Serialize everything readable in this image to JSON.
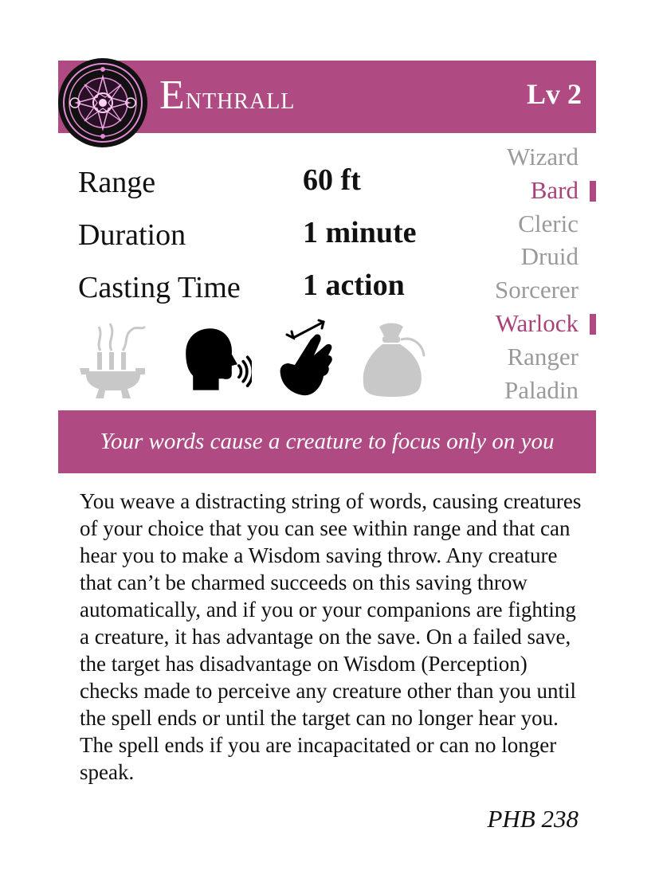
{
  "spell": {
    "name_first": "E",
    "name_rest": "nthrall",
    "level": "Lv 2",
    "school_icon": "enchantment-seal-icon"
  },
  "stats": {
    "range_label": "Range",
    "range_value": "60 ft",
    "duration_label": "Duration",
    "duration_value": "1 minute",
    "casting_label": "Casting Time",
    "casting_value": "1 action"
  },
  "classes": [
    {
      "name": "Wizard",
      "active": false
    },
    {
      "name": "Bard",
      "active": true
    },
    {
      "name": "Cleric",
      "active": false
    },
    {
      "name": "Druid",
      "active": false
    },
    {
      "name": "Sorcerer",
      "active": false
    },
    {
      "name": "Warlock",
      "active": true
    },
    {
      "name": "Ranger",
      "active": false
    },
    {
      "name": "Paladin",
      "active": false
    }
  ],
  "components": {
    "ritual": {
      "icon": "ritual-incense-icon",
      "active": false
    },
    "verbal": {
      "icon": "verbal-speaking-head-icon",
      "active": true
    },
    "somatic": {
      "icon": "somatic-hand-icon",
      "active": true
    },
    "material": {
      "icon": "material-pouch-icon",
      "active": false
    }
  },
  "colors": {
    "accent": "#b04a82",
    "active_class": "#a8437a",
    "inactive": "#9a9a9a"
  },
  "tagline": "Your words cause a creature to focus only on you",
  "description": "You weave a distracting string of words, causing creatures of your choice that you can see within range and that can hear you to make a Wisdom saving throw. Any creature that can’t be charmed succeeds on this saving throw automatically, and if you or your companions are fighting a creature, it has advantage on the save. On a failed save, the target has disadvantage on Wisdom (Perception) checks made to perceive any creature other than you until the spell ends or until the target can no longer hear you. The spell ends if you are incapacitated or can no longer speak.",
  "source": "PHB 238"
}
